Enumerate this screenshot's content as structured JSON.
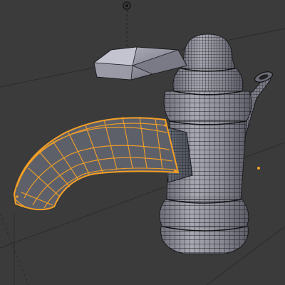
{
  "viewport": {
    "mode": "edit-mode-wireframe",
    "background_color": "#3b3b3b",
    "grid_color": "#2a2a2a",
    "accent_color": "#f5a025",
    "mesh_color": "#8e8e9a",
    "wire_color": "#1b1b1f"
  },
  "objects": [
    {
      "name": "faucet-body",
      "selected": false
    },
    {
      "name": "faucet-handle",
      "selected": false
    },
    {
      "name": "faucet-spout",
      "selected": true
    },
    {
      "name": "drain-lever",
      "selected": false
    }
  ],
  "markers": [
    {
      "name": "camera-origin-icon"
    },
    {
      "name": "object-origin-dot"
    }
  ]
}
